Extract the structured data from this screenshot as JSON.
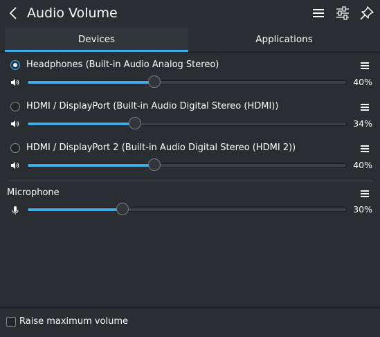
{
  "header": {
    "title": "Audio Volume",
    "back_icon": "chevron-left-icon",
    "menu_icon": "hamburger-menu-icon",
    "configure_icon": "configure-sliders-icon",
    "pin_icon": "pin-icon"
  },
  "tabs": [
    {
      "label": "Devices",
      "active": true
    },
    {
      "label": "Applications",
      "active": false
    }
  ],
  "devices": [
    {
      "name": "Headphones (Built-in Audio Analog Stereo)",
      "selected": true,
      "volume": 40,
      "volume_label": "40%"
    },
    {
      "name": "HDMI / DisplayPort (Built-in Audio Digital Stereo (HDMI))",
      "selected": false,
      "volume": 34,
      "volume_label": "34%"
    },
    {
      "name": "HDMI / DisplayPort 2 (Built-in Audio Digital Stereo (HDMI 2))",
      "selected": false,
      "volume": 40,
      "volume_label": "40%"
    }
  ],
  "microphone": {
    "label": "Microphone",
    "volume": 30,
    "volume_label": "30%"
  },
  "footer": {
    "raise_max_label": "Raise maximum volume",
    "checked": false
  },
  "colors": {
    "accent": "#3daee9",
    "background": "#2a2e32",
    "text": "#fcfcfc"
  }
}
